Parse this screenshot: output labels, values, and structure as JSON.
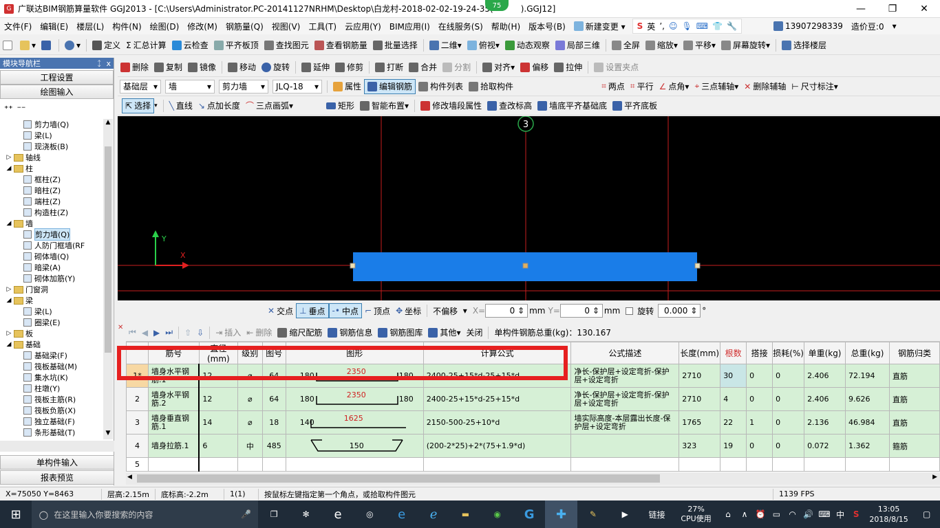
{
  "window": {
    "title": "广联达BIM钢筋算量软件 GGJ2013 - [C:\\Users\\Administrator.PC-20141127NRHM\\Desktop\\白龙村-2018-02-02-19-24-35(",
    "title_tail": ").GGJ12]",
    "badge": "75"
  },
  "menu": [
    "文件(F)",
    "编辑(E)",
    "楼层(L)",
    "构件(N)",
    "绘图(D)",
    "修改(M)",
    "钢筋量(Q)",
    "视图(V)",
    "工具(T)",
    "云应用(Y)",
    "BIM应用(I)",
    "在线服务(S)",
    "帮助(H)",
    "版本号(B)",
    "新建变更",
    "13907298339",
    "造价豆:0"
  ],
  "toolbar1": [
    "定义",
    "汇总计算",
    "云检查",
    "平齐板顶",
    "查找图元",
    "查看钢筋量",
    "批量选择",
    "二维",
    "俯视",
    "动态观察",
    "局部三维",
    "全屏",
    "缩放",
    "平移",
    "屏幕旋转",
    "选择楼层"
  ],
  "toolbar2": [
    "删除",
    "复制",
    "镜像",
    "移动",
    "旋转",
    "延伸",
    "修剪",
    "打断",
    "合并",
    "分割",
    "对齐",
    "偏移",
    "拉伸",
    "设置夹点"
  ],
  "toolbar3": {
    "layer": "基础层",
    "category": "墙",
    "type": "剪力墙",
    "component": "JLQ-18",
    "buttons": [
      "属性",
      "编辑钢筋",
      "构件列表",
      "拾取构件",
      "两点",
      "平行",
      "点角",
      "三点辅轴",
      "删除辅轴",
      "尺寸标注"
    ]
  },
  "toolbar4": [
    "选择",
    "直线",
    "点加长度",
    "三点画弧",
    "矩形",
    "智能布置",
    "修改墙段属性",
    "查改标高",
    "墙底平齐基础底",
    "平齐底板"
  ],
  "leftpanel": {
    "title": "模块导航栏",
    "pin": "ᛨ",
    "close": "x",
    "btn_project": "工程设置",
    "btn_draw": "绘图输入",
    "btn_single": "单构件输入",
    "btn_report": "报表预览",
    "tree": [
      {
        "level": 2,
        "label": "剪力墙(Q)",
        "kind": "item"
      },
      {
        "level": 2,
        "label": "梁(L)",
        "kind": "item"
      },
      {
        "level": 2,
        "label": "现浇板(B)",
        "kind": "item"
      },
      {
        "level": 0,
        "label": "轴线",
        "kind": "folder",
        "exp": "▷"
      },
      {
        "level": 0,
        "label": "柱",
        "kind": "folder",
        "exp": "◢"
      },
      {
        "level": 2,
        "label": "框柱(Z)",
        "kind": "item"
      },
      {
        "level": 2,
        "label": "暗柱(Z)",
        "kind": "item"
      },
      {
        "level": 2,
        "label": "端柱(Z)",
        "kind": "item"
      },
      {
        "level": 2,
        "label": "构造柱(Z)",
        "kind": "item"
      },
      {
        "level": 0,
        "label": "墙",
        "kind": "folder",
        "exp": "◢"
      },
      {
        "level": 2,
        "label": "剪力墙(Q)",
        "kind": "item",
        "selected": true
      },
      {
        "level": 2,
        "label": "人防门框墙(RF",
        "kind": "item"
      },
      {
        "level": 2,
        "label": "砌体墙(Q)",
        "kind": "item"
      },
      {
        "level": 2,
        "label": "暗梁(A)",
        "kind": "item"
      },
      {
        "level": 2,
        "label": "砌体加筋(Y)",
        "kind": "item"
      },
      {
        "level": 0,
        "label": "门窗洞",
        "kind": "folder",
        "exp": "▷"
      },
      {
        "level": 0,
        "label": "梁",
        "kind": "folder",
        "exp": "◢"
      },
      {
        "level": 2,
        "label": "梁(L)",
        "kind": "item"
      },
      {
        "level": 2,
        "label": "圈梁(E)",
        "kind": "item"
      },
      {
        "level": 0,
        "label": "板",
        "kind": "folder",
        "exp": "▷"
      },
      {
        "level": 0,
        "label": "基础",
        "kind": "folder",
        "exp": "◢"
      },
      {
        "level": 2,
        "label": "基础梁(F)",
        "kind": "item"
      },
      {
        "level": 2,
        "label": "筏板基础(M)",
        "kind": "item"
      },
      {
        "level": 2,
        "label": "集水坑(K)",
        "kind": "item"
      },
      {
        "level": 2,
        "label": "柱墩(Y)",
        "kind": "item"
      },
      {
        "level": 2,
        "label": "筏板主筋(R)",
        "kind": "item"
      },
      {
        "level": 2,
        "label": "筏板负筋(X)",
        "kind": "item"
      },
      {
        "level": 2,
        "label": "独立基础(F)",
        "kind": "item"
      },
      {
        "level": 2,
        "label": "条形基础(T)",
        "kind": "item"
      }
    ]
  },
  "canvas": {
    "axis_label": "3",
    "axis_y": "Y",
    "axis_x": "X"
  },
  "snapbar": {
    "items": [
      "交点",
      "垂点",
      "中点",
      "顶点",
      "坐标"
    ],
    "offset_mode": "不偏移",
    "x_label": "X=",
    "x_value": "0",
    "y_label": "Y=",
    "y_value": "0",
    "unit": "mm",
    "rotate_label": "旋转",
    "rotate_value": "0.000",
    "degree": "°"
  },
  "gridtool": {
    "buttons": [
      "插入",
      "删除",
      "缩尺配筋",
      "钢筋信息",
      "钢筋图库",
      "其他",
      "关闭"
    ],
    "total_label": "单构件钢筋总重(kg)：",
    "total_value": "130.167"
  },
  "grid": {
    "headers": [
      "",
      "筋号",
      "直径(mm)",
      "级别",
      "图号",
      "图形",
      "计算公式",
      "公式描述",
      "长度(mm)",
      "根数",
      "搭接",
      "损耗(%)",
      "单重(kg)",
      "总重(kg)",
      "钢筋归类"
    ],
    "rows": [
      {
        "rn": "1*",
        "name": "墙身水平钢筋.1",
        "dia": "12",
        "grade": "⌀",
        "fig": "64",
        "shape_l": "180",
        "shape_m": "2350",
        "shape_r": "180",
        "formula": "2400-25+15*d-25+15*d",
        "desc": "净长-保护层+设定弯折-保护层+设定弯折",
        "len": "2710",
        "count": "30",
        "lap": "0",
        "loss": "0",
        "unit": "2.406",
        "total": "72.194",
        "cat": "直筋"
      },
      {
        "rn": "2",
        "name": "墙身水平钢筋.2",
        "dia": "12",
        "grade": "⌀",
        "fig": "64",
        "shape_l": "180",
        "shape_m": "2350",
        "shape_r": "180",
        "formula": "2400-25+15*d-25+15*d",
        "desc": "净长-保护层+设定弯折-保护层+设定弯折",
        "len": "2710",
        "count": "4",
        "lap": "0",
        "loss": "0",
        "unit": "2.406",
        "total": "9.626",
        "cat": "直筋"
      },
      {
        "rn": "3",
        "name": "墙身垂直钢筋.1",
        "dia": "14",
        "grade": "⌀",
        "fig": "18",
        "shape_l": "140",
        "shape_m": "1625",
        "shape_r": "",
        "formula": "2150-500-25+10*d",
        "desc": "墙实际高度-本层露出长度-保护层+设定弯折",
        "len": "1765",
        "count": "22",
        "lap": "1",
        "loss": "0",
        "unit": "2.136",
        "total": "46.984",
        "cat": "直筋"
      },
      {
        "rn": "4",
        "name": "墙身拉筋.1",
        "dia": "6",
        "grade": "中",
        "fig": "485",
        "shape_l": "",
        "shape_m": "150",
        "shape_r": "",
        "formula": "(200-2*25)+2*(75+1.9*d)",
        "desc": "",
        "len": "323",
        "count": "19",
        "lap": "0",
        "loss": "0",
        "unit": "0.072",
        "total": "1.362",
        "cat": "箍筋"
      },
      {
        "rn": "5",
        "name": "",
        "dia": "",
        "grade": "",
        "fig": "",
        "shape_l": "",
        "shape_m": "",
        "shape_r": "",
        "formula": "",
        "desc": "",
        "len": "",
        "count": "",
        "lap": "",
        "loss": "",
        "unit": "",
        "total": "",
        "cat": ""
      }
    ]
  },
  "status": [
    "X=75050 Y=8463",
    "层高:2.15m",
    "底标高:-2.2m",
    "1(1)",
    "按鼠标左键指定第一个角点，或拾取构件图元",
    "1139 FPS"
  ],
  "taskbar": {
    "search_placeholder": "在这里输入你要搜索的内容",
    "cpu_pct": "27%",
    "cpu_label": "CPU使用",
    "link": "链接",
    "ime": "中",
    "time": "13:05",
    "date": "2018/8/15"
  },
  "colors": {
    "accent": "#4a74b0",
    "wall": "#1a7de8",
    "axis": "#c81e1e",
    "rowgreen": "#d6f0d6",
    "highlight": "#e62020"
  }
}
